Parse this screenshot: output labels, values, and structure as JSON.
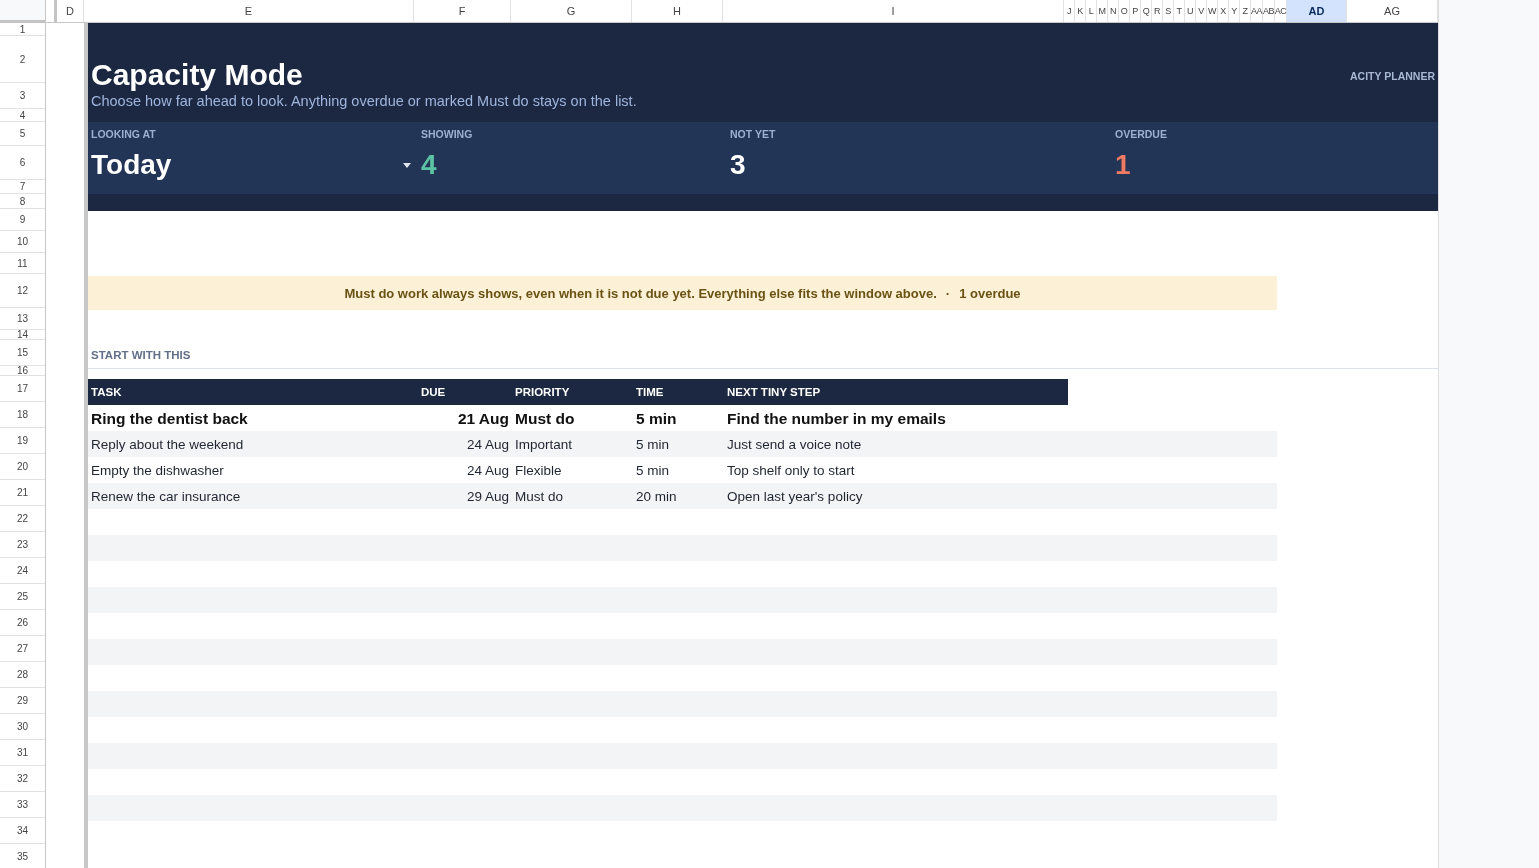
{
  "columns": [
    {
      "label": "D",
      "selected": false
    },
    {
      "label": "E",
      "selected": false
    },
    {
      "label": "F",
      "selected": false
    },
    {
      "label": "G",
      "selected": false
    },
    {
      "label": "H",
      "selected": false
    },
    {
      "label": "I",
      "selected": false
    },
    {
      "label": "J",
      "selected": false
    },
    {
      "label": "K",
      "selected": false
    },
    {
      "label": "L",
      "selected": false
    },
    {
      "label": "M",
      "selected": false
    },
    {
      "label": "N",
      "selected": false
    },
    {
      "label": "O",
      "selected": false
    },
    {
      "label": "P",
      "selected": false
    },
    {
      "label": "Q",
      "selected": false
    },
    {
      "label": "R",
      "selected": false
    },
    {
      "label": "S",
      "selected": false
    },
    {
      "label": "T",
      "selected": false
    },
    {
      "label": "U",
      "selected": false
    },
    {
      "label": "V",
      "selected": false
    },
    {
      "label": "W",
      "selected": false
    },
    {
      "label": "X",
      "selected": false
    },
    {
      "label": "Y",
      "selected": false
    },
    {
      "label": "Z",
      "selected": false
    },
    {
      "label": "AA",
      "selected": false
    },
    {
      "label": "AB",
      "selected": false
    },
    {
      "label": "AC",
      "selected": false
    },
    {
      "label": "AD",
      "selected": true
    },
    {
      "label": "AG",
      "selected": false
    }
  ],
  "row_numbers": [
    "1",
    "2",
    "3",
    "4",
    "5",
    "6",
    "7",
    "8",
    "9",
    "10",
    "11",
    "12",
    "13",
    "14",
    "15",
    "16",
    "17",
    "18",
    "19",
    "20",
    "21",
    "22",
    "23",
    "24",
    "25",
    "26",
    "27",
    "28",
    "29",
    "30",
    "31",
    "32",
    "33",
    "34",
    "35"
  ],
  "banner": {
    "title": "Capacity Mode",
    "subtitle": "Choose how far ahead to look. Anything overdue or marked Must do stays on the list.",
    "tag": "ACITY PLANNER"
  },
  "stats": [
    {
      "label": "LOOKING AT",
      "value": "Today",
      "kind": "dropdown",
      "color": "#ffffff"
    },
    {
      "label": "SHOWING",
      "value": "4",
      "kind": "count",
      "color": "#5cc4a4"
    },
    {
      "label": "NOT YET",
      "value": "3",
      "kind": "count",
      "color": "#ffffff"
    },
    {
      "label": "OVERDUE",
      "value": "1",
      "kind": "count",
      "color": "#ee7a64"
    }
  ],
  "notice": {
    "text": "Must do work always shows, even when it is not due yet. Everything else fits the window above.",
    "separator": "·",
    "count": "1 overdue"
  },
  "section_title": "START WITH THIS",
  "table": {
    "columns": [
      "TASK",
      "DUE",
      "PRIORITY",
      "TIME",
      "NEXT TINY STEP"
    ],
    "rows": [
      {
        "task": "Ring the dentist back",
        "due": "21 Aug",
        "priority": "Must do",
        "time": "5 min",
        "next": "Find the number in my emails",
        "featured": true
      },
      {
        "task": "Reply about the weekend",
        "due": "24 Aug",
        "priority": "Important",
        "time": "5 min",
        "next": "Just send a voice note",
        "featured": false
      },
      {
        "task": "Empty the dishwasher",
        "due": "24 Aug",
        "priority": "Flexible",
        "time": "5 min",
        "next": "Top shelf only to start",
        "featured": false
      },
      {
        "task": "Renew the car insurance",
        "due": "29 Aug",
        "priority": "Must do",
        "time": "20 min",
        "next": "Open last year's policy",
        "featured": false
      }
    ]
  }
}
